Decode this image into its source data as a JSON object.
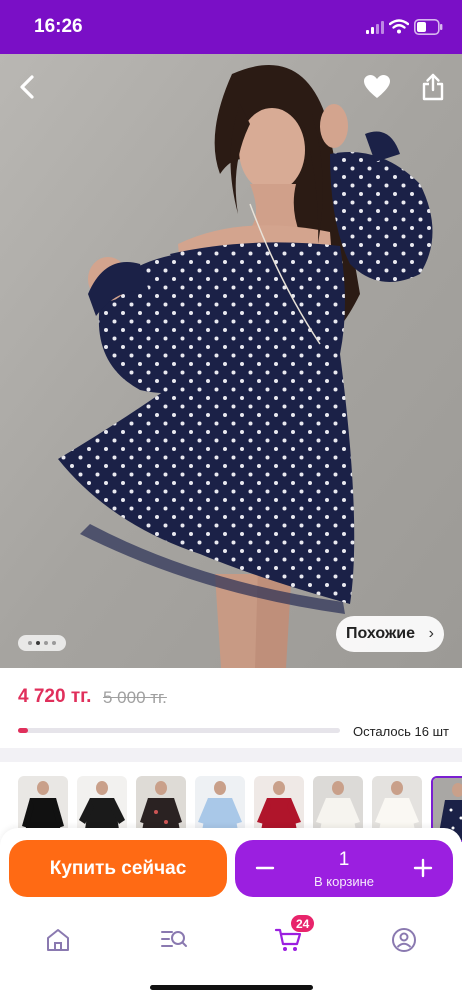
{
  "status_bar": {
    "time": "16:26",
    "icons": [
      "signal-icon",
      "wifi-icon",
      "battery-icon"
    ]
  },
  "product": {
    "photo_description_icons": [
      "back-arrow-icon",
      "heart-icon",
      "share-icon"
    ],
    "gallery": {
      "current_index": 1,
      "total_images": 4
    },
    "similar_label": "Похожие",
    "price_current": "4 720 тг.",
    "price_old": "5 000 тг.",
    "stock_text": "Осталось 16 шт",
    "stock_level": 0.03
  },
  "variants": {
    "count_visible": 8,
    "selected_index": 7
  },
  "actions": {
    "buy_label": "Купить сейчас",
    "cart_quantity": "1",
    "cart_sub_label": "В корзине"
  },
  "tab_bar": {
    "tabs": [
      "home-icon",
      "catalog-search-icon",
      "cart-icon",
      "profile-icon"
    ],
    "cart_badge": "24"
  },
  "colors": {
    "brand_purple": "#7a0fc6",
    "price_red": "#e02f5b",
    "buy_orange": "#ff6a14",
    "cart_purple": "#9b1fe0",
    "badge_pink": "#e8246b",
    "tab_icon": "#7f6ea6"
  }
}
